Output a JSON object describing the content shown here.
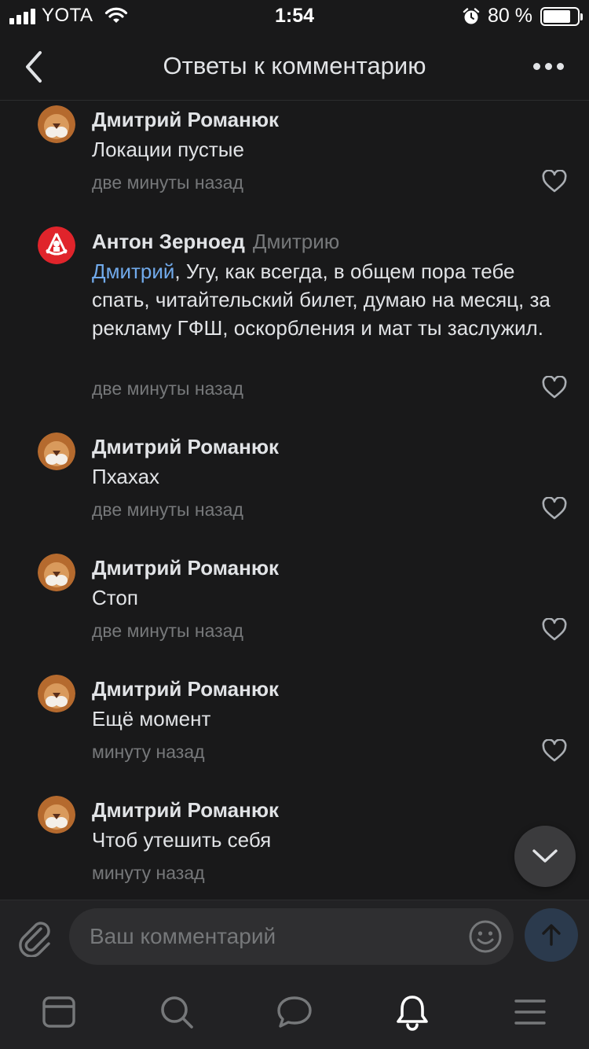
{
  "status_bar": {
    "carrier": "YOTA",
    "time": "1:54",
    "battery_text": "80 %",
    "battery_level_percent": 80
  },
  "nav": {
    "title": "Ответы к комментарию",
    "back_icon": "chevron-left-icon",
    "more_icon": "more-horizontal-icon"
  },
  "comments": [
    {
      "author": "Дмитрий Романюк",
      "text": "Локации пустые",
      "time": "две минуты назад",
      "avatar": "lion-avatar"
    },
    {
      "author": "Антон Зерноед",
      "reply_to": "Дмитрию",
      "mention": "Дмитрий",
      "text": ", Угу, как всегда, в общем пора тебе спать, читайтельский билет, думаю на месяц, за рекламу ГФШ, оскорбления и мат ты заслужил.",
      "time": "две минуты назад",
      "avatar": "mason-emblem-avatar"
    },
    {
      "author": "Дмитрий Романюк",
      "text": "Пхахах",
      "time": "две минуты назад",
      "avatar": "lion-avatar"
    },
    {
      "author": "Дмитрий Романюк",
      "text": "Стоп",
      "time": "две минуты назад",
      "avatar": "lion-avatar"
    },
    {
      "author": "Дмитрий Романюк",
      "text": "Ещё момент",
      "time": "минуту назад",
      "avatar": "lion-avatar"
    },
    {
      "author": "Дмитрий Романюк",
      "text": "Чтоб утешить себя",
      "time": "минуту назад",
      "avatar": "lion-avatar"
    }
  ],
  "composer": {
    "placeholder": "Ваш комментарий"
  },
  "colors": {
    "background": "#19191a",
    "panel": "#222224",
    "text": "#e1e3e6",
    "secondary": "#76787a",
    "link": "#71aaeb"
  },
  "tab_bar": [
    "news-icon",
    "search-icon",
    "messages-icon",
    "notifications-icon",
    "menu-icon"
  ]
}
